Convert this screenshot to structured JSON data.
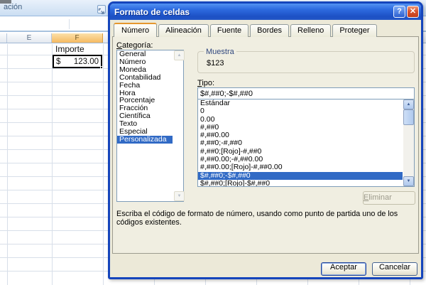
{
  "colors": {
    "selection_blue": "#316AC5",
    "dialog_bg": "#ECE9D8",
    "titlebar_blue": "#2E6BE0",
    "window_border_blue": "#1545BC",
    "selected_column_orange": "#F5B961",
    "close_button_red": "#D85430",
    "gridline": "#D8DFE9"
  },
  "excel": {
    "ribbon_group_label": "ación",
    "columns": {
      "e": "E",
      "f": "F"
    },
    "cells": {
      "f1": "Importe",
      "f2_symbol": "$",
      "f2_value": "123.00"
    }
  },
  "dialog": {
    "title": "Formato de celdas",
    "titlebar_icons": {
      "help": "?",
      "close": "✕"
    },
    "tabs": [
      {
        "label": "Número",
        "active": true
      },
      {
        "label": "Alineación"
      },
      {
        "label": "Fuente"
      },
      {
        "label": "Bordes"
      },
      {
        "label": "Relleno"
      },
      {
        "label": "Proteger"
      }
    ],
    "category": {
      "label_accel": "C",
      "label_rest": "ategoría:",
      "items": [
        "General",
        "Número",
        "Moneda",
        "Contabilidad",
        "Fecha",
        "Hora",
        "Porcentaje",
        "Fracción",
        "Científica",
        "Texto",
        "Especial",
        {
          "label": "Personalizada",
          "selected": true
        }
      ]
    },
    "sample": {
      "group_label": "Muestra",
      "value": "$123"
    },
    "type": {
      "label_accel": "T",
      "label_rest": "ipo:",
      "input_value": "$#,##0;-$#,##0",
      "items": [
        "Estándar",
        "0",
        "0.00",
        "#,##0",
        "#,##0.00",
        "#,##0;-#,##0",
        "#,##0;[Rojo]-#,##0",
        "#,##0.00;-#,##0.00",
        "#,##0.00;[Rojo]-#,##0.00",
        {
          "label": "$#,##0;-$#,##0",
          "selected": true
        },
        "$#,##0;[Rojo]-$#,##0"
      ]
    },
    "delete_button": {
      "label_accel": "E",
      "label_rest": "liminar"
    },
    "description": "Escriba el código de formato de número, usando como punto de partida uno de los códigos existentes.",
    "ok_label": "Aceptar",
    "cancel_label": "Cancelar",
    "scroll_icons": {
      "up": "▲",
      "down": "▼"
    }
  }
}
